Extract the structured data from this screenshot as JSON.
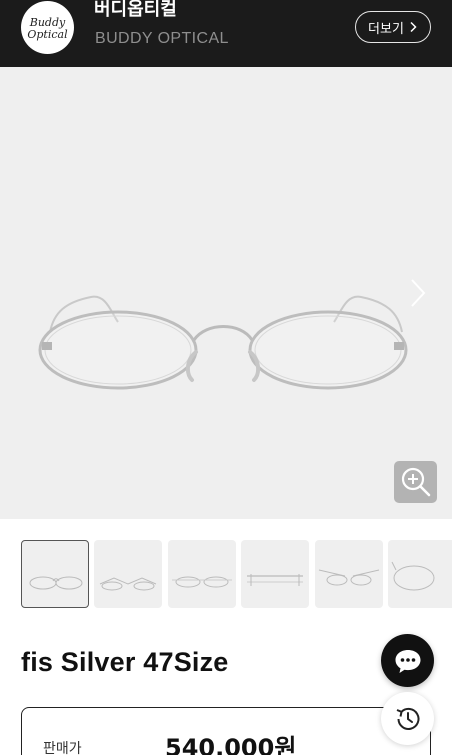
{
  "header": {
    "logo_text": "Buddy Optical",
    "brand_name": "버디옵티컬",
    "brand_sub": "BUDDY OPTICAL",
    "more_label": "더보기",
    "bg_color": "#1b1b1b"
  },
  "gallery": {
    "main_image": "silver oval metal eyeglasses",
    "next_icon": "chevron-right-icon",
    "zoom_icon": "zoom-in-icon",
    "thumbnail_count": 6,
    "active_thumbnail": 1
  },
  "product": {
    "title": "fis Silver 47Size",
    "price_label": "판매가",
    "price_value": "540,000원"
  },
  "floating": {
    "chat_icon": "chat-bubble-icon",
    "recent_icon": "history-icon"
  }
}
